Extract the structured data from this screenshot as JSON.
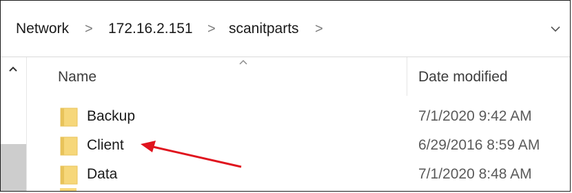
{
  "breadcrumb": {
    "items": [
      "Network",
      "172.16.2.151",
      "scanitparts"
    ],
    "separator": ">"
  },
  "address_bar": {
    "history_icon": "chevron-down-icon"
  },
  "columns": {
    "name": "Name",
    "date_modified": "Date modified",
    "sort_indicator": "chevron-up-icon"
  },
  "files": [
    {
      "name": "Backup",
      "date_modified": "7/1/2020 9:42 AM",
      "icon": "folder-icon"
    },
    {
      "name": "Client",
      "date_modified": "6/29/2016 8:59 AM",
      "icon": "folder-icon"
    },
    {
      "name": "Data",
      "date_modified": "7/1/2020 8:48 AM",
      "icon": "folder-icon"
    }
  ],
  "annotation": {
    "type": "arrow",
    "color": "#e0141e",
    "points_to": "Client"
  },
  "colors": {
    "folder": "#f6d77a",
    "folder_dark": "#e8c35a",
    "scrollbar_thumb": "#cdcdcd"
  }
}
